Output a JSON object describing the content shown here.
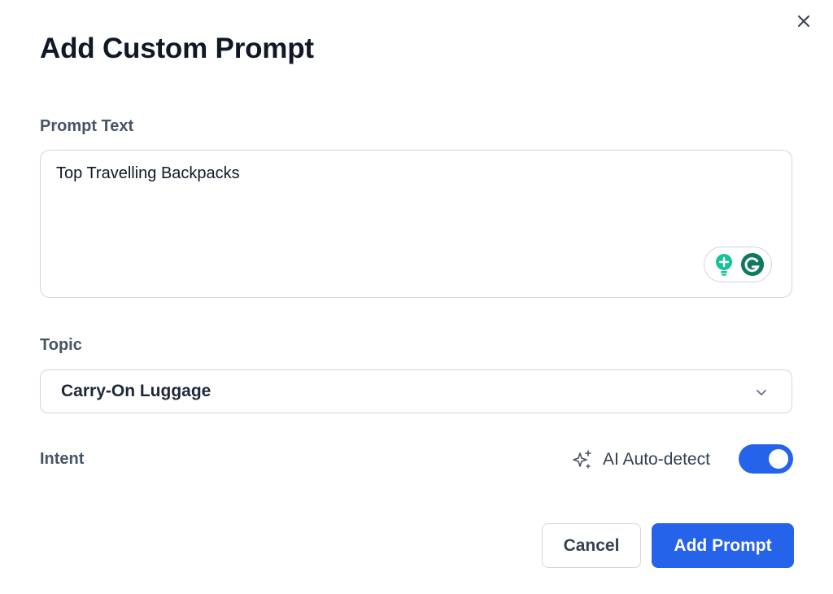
{
  "dialog": {
    "title": "Add Custom Prompt"
  },
  "prompt_text": {
    "label": "Prompt Text",
    "value": "Top Travelling Backpacks"
  },
  "topic": {
    "label": "Topic",
    "selected": "Carry-On Luggage"
  },
  "intent": {
    "label": "Intent",
    "ai_label": "AI Auto-detect",
    "auto_detect_on": true
  },
  "actions": {
    "cancel_label": "Cancel",
    "submit_label": "Add Prompt"
  },
  "colors": {
    "primary": "#2563eb",
    "grammarly_green": "#15C39A",
    "grammarly_dark": "#0d7a5f"
  },
  "icons": {
    "close": "close-icon",
    "chevron": "chevron-down-icon",
    "sparkle": "sparkle-icon",
    "grammarly": "grammarly-icon",
    "lightbulb": "lightbulb-icon"
  }
}
